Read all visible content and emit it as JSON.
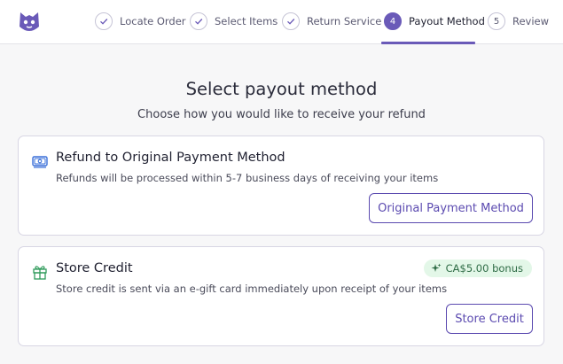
{
  "steps": [
    {
      "label": "Locate Order",
      "state": "done"
    },
    {
      "label": "Select Items",
      "state": "done"
    },
    {
      "label": "Return Service",
      "state": "done"
    },
    {
      "label": "Payout Method",
      "state": "active",
      "number": "4"
    },
    {
      "label": "Review",
      "state": "upcoming",
      "number": "5"
    }
  ],
  "colors": {
    "accent": "#6a5ab8",
    "button": "#5b4ab0",
    "bonus_bg": "#e3f7e8",
    "bonus_text": "#2e6b45",
    "gift_icon": "#2e9a5a",
    "money_icon": "#3a6fd8"
  },
  "page": {
    "title": "Select payout method",
    "subtitle": "Choose how you would like to receive your refund"
  },
  "options": [
    {
      "icon": "money-icon",
      "title": "Refund to Original Payment Method",
      "description": "Refunds will be processed within 5-7 business days of receiving your items",
      "button": "Original Payment Method"
    },
    {
      "icon": "gift-icon",
      "title": "Store Credit",
      "description": "Store credit is sent via an e-gift card immediately upon receipt of your items",
      "button": "Store Credit",
      "badge": "CA$5.00 bonus",
      "badge_icon": "sparkle-icon"
    }
  ]
}
